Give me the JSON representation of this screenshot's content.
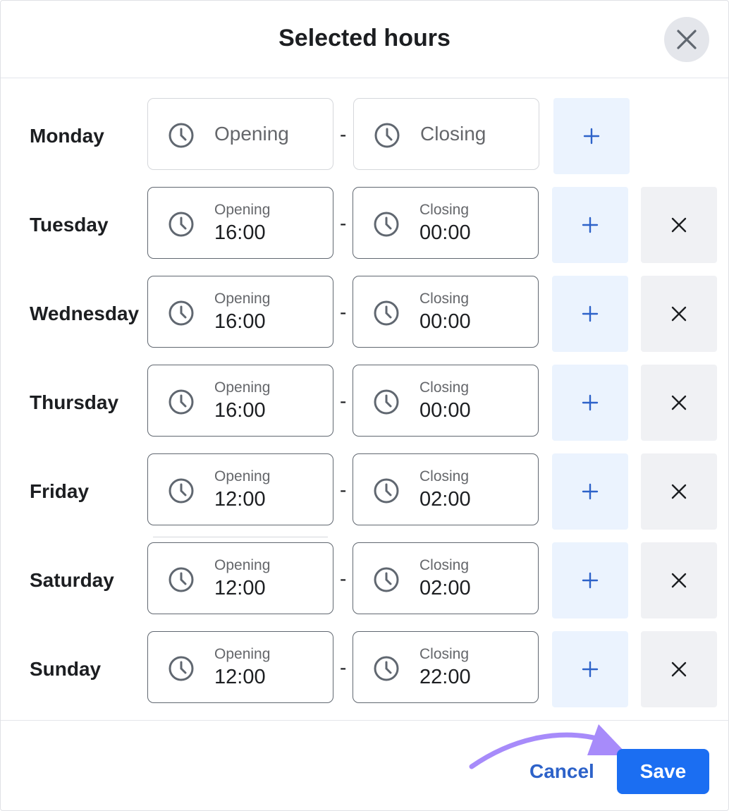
{
  "dialog": {
    "title": "Selected hours",
    "close_icon": "close-icon"
  },
  "placeholders": {
    "opening": "Opening",
    "closing": "Closing"
  },
  "separator": "-",
  "days": [
    {
      "label": "Monday",
      "opening": "",
      "closing": "",
      "removable": false
    },
    {
      "label": "Tuesday",
      "opening": "16:00",
      "closing": "00:00",
      "removable": true
    },
    {
      "label": "Wednesday",
      "opening": "16:00",
      "closing": "00:00",
      "removable": true
    },
    {
      "label": "Thursday",
      "opening": "16:00",
      "closing": "00:00",
      "removable": true
    },
    {
      "label": "Friday",
      "opening": "12:00",
      "closing": "02:00",
      "removable": true
    },
    {
      "label": "Saturday",
      "opening": "12:00",
      "closing": "02:00",
      "removable": true
    },
    {
      "label": "Sunday",
      "opening": "12:00",
      "closing": "22:00",
      "removable": true
    }
  ],
  "footer": {
    "cancel_label": "Cancel",
    "save_label": "Save"
  },
  "colors": {
    "accent": "#1b6ef2",
    "cancel_text": "#2d62c9",
    "add_button_bg": "#ebf3fe",
    "remove_button_bg": "#f0f1f4",
    "annotation_arrow": "#a78bfa"
  },
  "icons": {
    "clock": "clock-icon",
    "add": "plus-icon",
    "remove": "x-icon"
  }
}
